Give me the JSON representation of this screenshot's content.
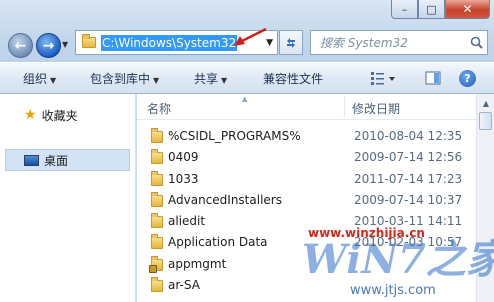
{
  "window": {
    "minimize_glyph": "–",
    "maximize_glyph": "□",
    "close_glyph": "✕"
  },
  "address_bar": {
    "path": "C:\\Windows\\System32"
  },
  "search": {
    "placeholder": "搜索 System32"
  },
  "toolbar": {
    "organize": "组织",
    "include_in_library": "包含到库中",
    "share": "共享",
    "compatibility_files": "兼容性文件"
  },
  "navpane": {
    "favorites": "收藏夹",
    "desktop": "桌面"
  },
  "columns": {
    "name": "名称",
    "modified": "修改日期"
  },
  "files": [
    {
      "name": "%CSIDL_PROGRAMS%",
      "date": "2010-08-04 12:35",
      "locked": false
    },
    {
      "name": "0409",
      "date": "2009-07-14 12:56",
      "locked": false
    },
    {
      "name": "1033",
      "date": "2011-07-14 17:23",
      "locked": false
    },
    {
      "name": "AdvancedInstallers",
      "date": "2009-07-14 10:37",
      "locked": false
    },
    {
      "name": "aliedit",
      "date": "2010-03-11 14:11",
      "locked": false
    },
    {
      "name": "Application Data",
      "date": "2010-02-03 10:57",
      "locked": false
    },
    {
      "name": "appmgmt",
      "date": "",
      "locked": true
    },
    {
      "name": "ar-SA",
      "date": "",
      "locked": false
    }
  ],
  "watermark": {
    "url": "www.winzhijia.cn",
    "logo": "WiN7之家",
    "site": "www.jtjs.com"
  },
  "colors": {
    "selection": "#3399ff",
    "annotation_arrow": "#d0201a",
    "watermark_red": "#d32a1e"
  }
}
